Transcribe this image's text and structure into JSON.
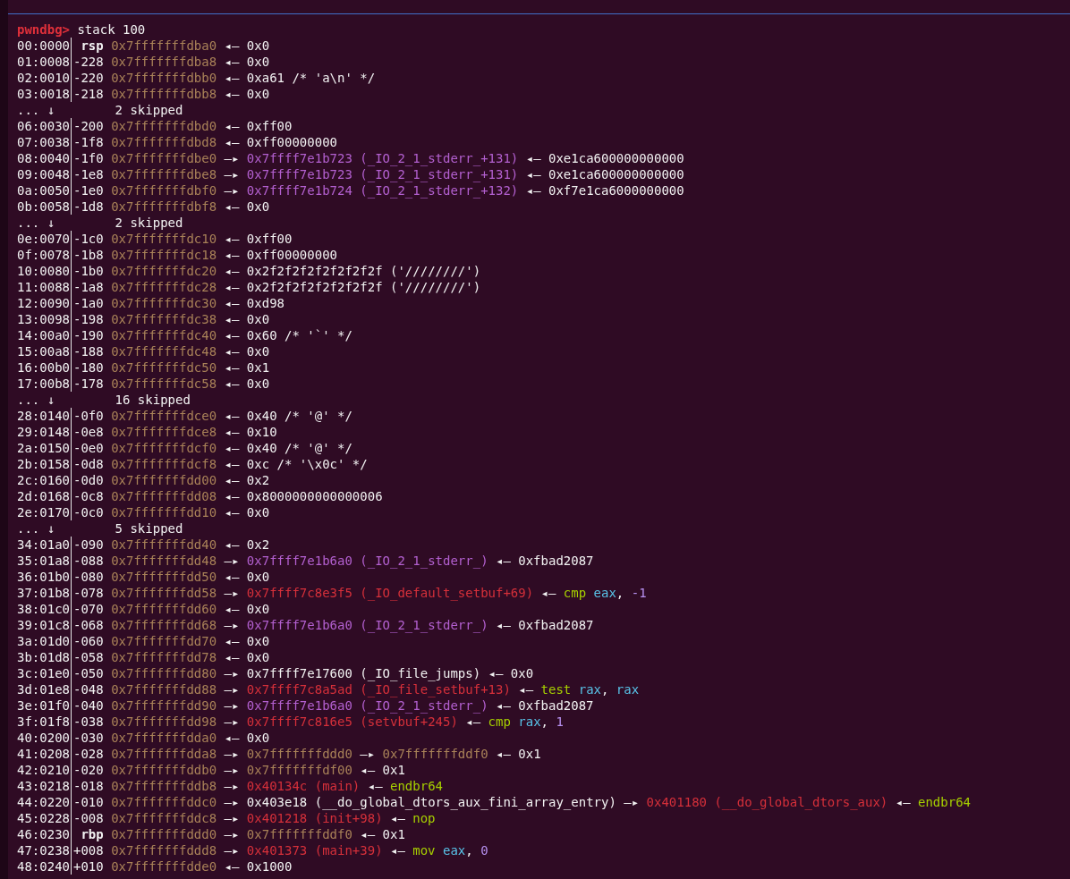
{
  "prompt": {
    "label": "pwndbg>",
    "command": "stack 100"
  },
  "lines": [
    {
      "kind": "entry",
      "index": "00:0000",
      "offset": {
        "text": "rsp",
        "kind": "register"
      },
      "segments": [
        {
          "text": "0x7fffffffdba0",
          "kind": "stack"
        },
        {
          "text": "◂—",
          "kind": "arrow"
        },
        {
          "text": "0x0",
          "kind": "plain"
        }
      ]
    },
    {
      "kind": "entry",
      "index": "01:0008",
      "offset": {
        "text": "-228",
        "kind": "number"
      },
      "segments": [
        {
          "text": "0x7fffffffdba8",
          "kind": "stack"
        },
        {
          "text": "◂—",
          "kind": "arrow"
        },
        {
          "text": "0x0",
          "kind": "plain"
        }
      ]
    },
    {
      "kind": "entry",
      "index": "02:0010",
      "offset": {
        "text": "-220",
        "kind": "number"
      },
      "segments": [
        {
          "text": "0x7fffffffdbb0",
          "kind": "stack"
        },
        {
          "text": "◂—",
          "kind": "arrow"
        },
        {
          "text": "0xa61 /* 'a\\n' */",
          "kind": "plain"
        }
      ]
    },
    {
      "kind": "entry",
      "index": "03:0018",
      "offset": {
        "text": "-218",
        "kind": "number"
      },
      "segments": [
        {
          "text": "0x7fffffffdbb8",
          "kind": "stack"
        },
        {
          "text": "◂—",
          "kind": "arrow"
        },
        {
          "text": "0x0",
          "kind": "plain"
        }
      ]
    },
    {
      "kind": "skip",
      "marker": "... ↓",
      "count": "2 skipped"
    },
    {
      "kind": "entry",
      "index": "06:0030",
      "offset": {
        "text": "-200",
        "kind": "number"
      },
      "segments": [
        {
          "text": "0x7fffffffdbd0",
          "kind": "stack"
        },
        {
          "text": "◂—",
          "kind": "arrow"
        },
        {
          "text": "0xff00",
          "kind": "plain"
        }
      ]
    },
    {
      "kind": "entry",
      "index": "07:0038",
      "offset": {
        "text": "-1f8",
        "kind": "number"
      },
      "segments": [
        {
          "text": "0x7fffffffdbd8",
          "kind": "stack"
        },
        {
          "text": "◂—",
          "kind": "arrow"
        },
        {
          "text": "0xff00000000",
          "kind": "plain"
        }
      ]
    },
    {
      "kind": "entry",
      "index": "08:0040",
      "offset": {
        "text": "-1f0",
        "kind": "number"
      },
      "segments": [
        {
          "text": "0x7fffffffdbe0",
          "kind": "stack"
        },
        {
          "text": "—▸",
          "kind": "arrow"
        },
        {
          "text": "0x7ffff7e1b723 (_IO_2_1_stderr_+131)",
          "kind": "data"
        },
        {
          "text": "◂—",
          "kind": "arrow"
        },
        {
          "text": "0xe1ca600000000000",
          "kind": "plain"
        }
      ]
    },
    {
      "kind": "entry",
      "index": "09:0048",
      "offset": {
        "text": "-1e8",
        "kind": "number"
      },
      "segments": [
        {
          "text": "0x7fffffffdbe8",
          "kind": "stack"
        },
        {
          "text": "—▸",
          "kind": "arrow"
        },
        {
          "text": "0x7ffff7e1b723 (_IO_2_1_stderr_+131)",
          "kind": "data"
        },
        {
          "text": "◂—",
          "kind": "arrow"
        },
        {
          "text": "0xe1ca600000000000",
          "kind": "plain"
        }
      ]
    },
    {
      "kind": "entry",
      "index": "0a:0050",
      "offset": {
        "text": "-1e0",
        "kind": "number"
      },
      "segments": [
        {
          "text": "0x7fffffffdbf0",
          "kind": "stack"
        },
        {
          "text": "—▸",
          "kind": "arrow"
        },
        {
          "text": "0x7ffff7e1b724 (_IO_2_1_stderr_+132)",
          "kind": "data"
        },
        {
          "text": "◂—",
          "kind": "arrow"
        },
        {
          "text": "0xf7e1ca6000000000",
          "kind": "plain"
        }
      ]
    },
    {
      "kind": "entry",
      "index": "0b:0058",
      "offset": {
        "text": "-1d8",
        "kind": "number"
      },
      "segments": [
        {
          "text": "0x7fffffffdbf8",
          "kind": "stack"
        },
        {
          "text": "◂—",
          "kind": "arrow"
        },
        {
          "text": "0x0",
          "kind": "plain"
        }
      ]
    },
    {
      "kind": "skip",
      "marker": "... ↓",
      "count": "2 skipped"
    },
    {
      "kind": "entry",
      "index": "0e:0070",
      "offset": {
        "text": "-1c0",
        "kind": "number"
      },
      "segments": [
        {
          "text": "0x7fffffffdc10",
          "kind": "stack"
        },
        {
          "text": "◂—",
          "kind": "arrow"
        },
        {
          "text": "0xff00",
          "kind": "plain"
        }
      ]
    },
    {
      "kind": "entry",
      "index": "0f:0078",
      "offset": {
        "text": "-1b8",
        "kind": "number"
      },
      "segments": [
        {
          "text": "0x7fffffffdc18",
          "kind": "stack"
        },
        {
          "text": "◂—",
          "kind": "arrow"
        },
        {
          "text": "0xff00000000",
          "kind": "plain"
        }
      ]
    },
    {
      "kind": "entry",
      "index": "10:0080",
      "offset": {
        "text": "-1b0",
        "kind": "number"
      },
      "segments": [
        {
          "text": "0x7fffffffdc20",
          "kind": "stack"
        },
        {
          "text": "◂—",
          "kind": "arrow"
        },
        {
          "text": "0x2f2f2f2f2f2f2f2f ('////////')",
          "kind": "plain"
        }
      ]
    },
    {
      "kind": "entry",
      "index": "11:0088",
      "offset": {
        "text": "-1a8",
        "kind": "number"
      },
      "segments": [
        {
          "text": "0x7fffffffdc28",
          "kind": "stack"
        },
        {
          "text": "◂—",
          "kind": "arrow"
        },
        {
          "text": "0x2f2f2f2f2f2f2f2f ('////////')",
          "kind": "plain"
        }
      ]
    },
    {
      "kind": "entry",
      "index": "12:0090",
      "offset": {
        "text": "-1a0",
        "kind": "number"
      },
      "segments": [
        {
          "text": "0x7fffffffdc30",
          "kind": "stack"
        },
        {
          "text": "◂—",
          "kind": "arrow"
        },
        {
          "text": "0xd98",
          "kind": "plain"
        }
      ]
    },
    {
      "kind": "entry",
      "index": "13:0098",
      "offset": {
        "text": "-198",
        "kind": "number"
      },
      "segments": [
        {
          "text": "0x7fffffffdc38",
          "kind": "stack"
        },
        {
          "text": "◂—",
          "kind": "arrow"
        },
        {
          "text": "0x0",
          "kind": "plain"
        }
      ]
    },
    {
      "kind": "entry",
      "index": "14:00a0",
      "offset": {
        "text": "-190",
        "kind": "number"
      },
      "segments": [
        {
          "text": "0x7fffffffdc40",
          "kind": "stack"
        },
        {
          "text": "◂—",
          "kind": "arrow"
        },
        {
          "text": "0x60 /* '`' */",
          "kind": "plain"
        }
      ]
    },
    {
      "kind": "entry",
      "index": "15:00a8",
      "offset": {
        "text": "-188",
        "kind": "number"
      },
      "segments": [
        {
          "text": "0x7fffffffdc48",
          "kind": "stack"
        },
        {
          "text": "◂—",
          "kind": "arrow"
        },
        {
          "text": "0x0",
          "kind": "plain"
        }
      ]
    },
    {
      "kind": "entry",
      "index": "16:00b0",
      "offset": {
        "text": "-180",
        "kind": "number"
      },
      "segments": [
        {
          "text": "0x7fffffffdc50",
          "kind": "stack"
        },
        {
          "text": "◂—",
          "kind": "arrow"
        },
        {
          "text": "0x1",
          "kind": "plain"
        }
      ]
    },
    {
      "kind": "entry",
      "index": "17:00b8",
      "offset": {
        "text": "-178",
        "kind": "number"
      },
      "segments": [
        {
          "text": "0x7fffffffdc58",
          "kind": "stack"
        },
        {
          "text": "◂—",
          "kind": "arrow"
        },
        {
          "text": "0x0",
          "kind": "plain"
        }
      ]
    },
    {
      "kind": "skip",
      "marker": "... ↓",
      "count": "16 skipped"
    },
    {
      "kind": "entry",
      "index": "28:0140",
      "offset": {
        "text": "-0f0",
        "kind": "number"
      },
      "segments": [
        {
          "text": "0x7fffffffdce0",
          "kind": "stack"
        },
        {
          "text": "◂—",
          "kind": "arrow"
        },
        {
          "text": "0x40 /* '@' */",
          "kind": "plain"
        }
      ]
    },
    {
      "kind": "entry",
      "index": "29:0148",
      "offset": {
        "text": "-0e8",
        "kind": "number"
      },
      "segments": [
        {
          "text": "0x7fffffffdce8",
          "kind": "stack"
        },
        {
          "text": "◂—",
          "kind": "arrow"
        },
        {
          "text": "0x10",
          "kind": "plain"
        }
      ]
    },
    {
      "kind": "entry",
      "index": "2a:0150",
      "offset": {
        "text": "-0e0",
        "kind": "number"
      },
      "segments": [
        {
          "text": "0x7fffffffdcf0",
          "kind": "stack"
        },
        {
          "text": "◂—",
          "kind": "arrow"
        },
        {
          "text": "0x40 /* '@' */",
          "kind": "plain"
        }
      ]
    },
    {
      "kind": "entry",
      "index": "2b:0158",
      "offset": {
        "text": "-0d8",
        "kind": "number"
      },
      "segments": [
        {
          "text": "0x7fffffffdcf8",
          "kind": "stack"
        },
        {
          "text": "◂—",
          "kind": "arrow"
        },
        {
          "text": "0xc /* '\\x0c' */",
          "kind": "plain"
        }
      ]
    },
    {
      "kind": "entry",
      "index": "2c:0160",
      "offset": {
        "text": "-0d0",
        "kind": "number"
      },
      "segments": [
        {
          "text": "0x7fffffffdd00",
          "kind": "stack"
        },
        {
          "text": "◂—",
          "kind": "arrow"
        },
        {
          "text": "0x2",
          "kind": "plain"
        }
      ]
    },
    {
      "kind": "entry",
      "index": "2d:0168",
      "offset": {
        "text": "-0c8",
        "kind": "number"
      },
      "segments": [
        {
          "text": "0x7fffffffdd08",
          "kind": "stack"
        },
        {
          "text": "◂—",
          "kind": "arrow"
        },
        {
          "text": "0x8000000000000006",
          "kind": "plain"
        }
      ]
    },
    {
      "kind": "entry",
      "index": "2e:0170",
      "offset": {
        "text": "-0c0",
        "kind": "number"
      },
      "segments": [
        {
          "text": "0x7fffffffdd10",
          "kind": "stack"
        },
        {
          "text": "◂—",
          "kind": "arrow"
        },
        {
          "text": "0x0",
          "kind": "plain"
        }
      ]
    },
    {
      "kind": "skip",
      "marker": "... ↓",
      "count": "5 skipped"
    },
    {
      "kind": "entry",
      "index": "34:01a0",
      "offset": {
        "text": "-090",
        "kind": "number"
      },
      "segments": [
        {
          "text": "0x7fffffffdd40",
          "kind": "stack"
        },
        {
          "text": "◂—",
          "kind": "arrow"
        },
        {
          "text": "0x2",
          "kind": "plain"
        }
      ]
    },
    {
      "kind": "entry",
      "index": "35:01a8",
      "offset": {
        "text": "-088",
        "kind": "number"
      },
      "segments": [
        {
          "text": "0x7fffffffdd48",
          "kind": "stack"
        },
        {
          "text": "—▸",
          "kind": "arrow"
        },
        {
          "text": "0x7ffff7e1b6a0 (_IO_2_1_stderr_)",
          "kind": "data"
        },
        {
          "text": "◂—",
          "kind": "arrow"
        },
        {
          "text": "0xfbad2087",
          "kind": "plain"
        }
      ]
    },
    {
      "kind": "entry",
      "index": "36:01b0",
      "offset": {
        "text": "-080",
        "kind": "number"
      },
      "segments": [
        {
          "text": "0x7fffffffdd50",
          "kind": "stack"
        },
        {
          "text": "◂—",
          "kind": "arrow"
        },
        {
          "text": "0x0",
          "kind": "plain"
        }
      ]
    },
    {
      "kind": "entry",
      "index": "37:01b8",
      "offset": {
        "text": "-078",
        "kind": "number"
      },
      "segments": [
        {
          "text": "0x7fffffffdd58",
          "kind": "stack"
        },
        {
          "text": "—▸",
          "kind": "arrow"
        },
        {
          "text": "0x7ffff7c8e3f5 (_IO_default_setbuf+69)",
          "kind": "code"
        },
        {
          "text": "◂—",
          "kind": "arrow"
        },
        {
          "text": "cmp",
          "kind": "mnemonic"
        },
        {
          "text": "eax",
          "kind": "register"
        },
        {
          "text": ",",
          "kind": "comma"
        },
        {
          "text": "-1",
          "kind": "number"
        }
      ]
    },
    {
      "kind": "entry",
      "index": "38:01c0",
      "offset": {
        "text": "-070",
        "kind": "number"
      },
      "segments": [
        {
          "text": "0x7fffffffdd60",
          "kind": "stack"
        },
        {
          "text": "◂—",
          "kind": "arrow"
        },
        {
          "text": "0x0",
          "kind": "plain"
        }
      ]
    },
    {
      "kind": "entry",
      "index": "39:01c8",
      "offset": {
        "text": "-068",
        "kind": "number"
      },
      "segments": [
        {
          "text": "0x7fffffffdd68",
          "kind": "stack"
        },
        {
          "text": "—▸",
          "kind": "arrow"
        },
        {
          "text": "0x7ffff7e1b6a0 (_IO_2_1_stderr_)",
          "kind": "data"
        },
        {
          "text": "◂—",
          "kind": "arrow"
        },
        {
          "text": "0xfbad2087",
          "kind": "plain"
        }
      ]
    },
    {
      "kind": "entry",
      "index": "3a:01d0",
      "offset": {
        "text": "-060",
        "kind": "number"
      },
      "segments": [
        {
          "text": "0x7fffffffdd70",
          "kind": "stack"
        },
        {
          "text": "◂—",
          "kind": "arrow"
        },
        {
          "text": "0x0",
          "kind": "plain"
        }
      ]
    },
    {
      "kind": "entry",
      "index": "3b:01d8",
      "offset": {
        "text": "-058",
        "kind": "number"
      },
      "segments": [
        {
          "text": "0x7fffffffdd78",
          "kind": "stack"
        },
        {
          "text": "◂—",
          "kind": "arrow"
        },
        {
          "text": "0x0",
          "kind": "plain"
        }
      ]
    },
    {
      "kind": "entry",
      "index": "3c:01e0",
      "offset": {
        "text": "-050",
        "kind": "number"
      },
      "segments": [
        {
          "text": "0x7fffffffdd80",
          "kind": "stack"
        },
        {
          "text": "—▸",
          "kind": "arrow"
        },
        {
          "text": "0x7ffff7e17600 (_IO_file_jumps)",
          "kind": "plain"
        },
        {
          "text": "◂—",
          "kind": "arrow"
        },
        {
          "text": "0x0",
          "kind": "plain"
        }
      ]
    },
    {
      "kind": "entry",
      "index": "3d:01e8",
      "offset": {
        "text": "-048",
        "kind": "number"
      },
      "segments": [
        {
          "text": "0x7fffffffdd88",
          "kind": "stack"
        },
        {
          "text": "—▸",
          "kind": "arrow"
        },
        {
          "text": "0x7ffff7c8a5ad (_IO_file_setbuf+13)",
          "kind": "code"
        },
        {
          "text": "◂—",
          "kind": "arrow"
        },
        {
          "text": "test",
          "kind": "mnemonic"
        },
        {
          "text": "rax",
          "kind": "register"
        },
        {
          "text": ",",
          "kind": "comma"
        },
        {
          "text": "rax",
          "kind": "register"
        }
      ]
    },
    {
      "kind": "entry",
      "index": "3e:01f0",
      "offset": {
        "text": "-040",
        "kind": "number"
      },
      "segments": [
        {
          "text": "0x7fffffffdd90",
          "kind": "stack"
        },
        {
          "text": "—▸",
          "kind": "arrow"
        },
        {
          "text": "0x7ffff7e1b6a0 (_IO_2_1_stderr_)",
          "kind": "data"
        },
        {
          "text": "◂—",
          "kind": "arrow"
        },
        {
          "text": "0xfbad2087",
          "kind": "plain"
        }
      ]
    },
    {
      "kind": "entry",
      "index": "3f:01f8",
      "offset": {
        "text": "-038",
        "kind": "number"
      },
      "segments": [
        {
          "text": "0x7fffffffdd98",
          "kind": "stack"
        },
        {
          "text": "—▸",
          "kind": "arrow"
        },
        {
          "text": "0x7ffff7c816e5 (setvbuf+245)",
          "kind": "code"
        },
        {
          "text": "◂—",
          "kind": "arrow"
        },
        {
          "text": "cmp",
          "kind": "mnemonic"
        },
        {
          "text": "rax",
          "kind": "register"
        },
        {
          "text": ",",
          "kind": "comma"
        },
        {
          "text": "1",
          "kind": "number"
        }
      ]
    },
    {
      "kind": "entry",
      "index": "40:0200",
      "offset": {
        "text": "-030",
        "kind": "number"
      },
      "segments": [
        {
          "text": "0x7fffffffdda0",
          "kind": "stack"
        },
        {
          "text": "◂—",
          "kind": "arrow"
        },
        {
          "text": "0x0",
          "kind": "plain"
        }
      ]
    },
    {
      "kind": "entry",
      "index": "41:0208",
      "offset": {
        "text": "-028",
        "kind": "number"
      },
      "segments": [
        {
          "text": "0x7fffffffdda8",
          "kind": "stack"
        },
        {
          "text": "—▸",
          "kind": "arrow"
        },
        {
          "text": "0x7fffffffddd0",
          "kind": "stack"
        },
        {
          "text": "—▸",
          "kind": "arrow"
        },
        {
          "text": "0x7fffffffddf0",
          "kind": "stack"
        },
        {
          "text": "◂—",
          "kind": "arrow"
        },
        {
          "text": "0x1",
          "kind": "plain"
        }
      ]
    },
    {
      "kind": "entry",
      "index": "42:0210",
      "offset": {
        "text": "-020",
        "kind": "number"
      },
      "segments": [
        {
          "text": "0x7fffffffddb0",
          "kind": "stack"
        },
        {
          "text": "—▸",
          "kind": "arrow"
        },
        {
          "text": "0x7fffffffdf00",
          "kind": "stack"
        },
        {
          "text": "◂—",
          "kind": "arrow"
        },
        {
          "text": "0x1",
          "kind": "plain"
        }
      ]
    },
    {
      "kind": "entry",
      "index": "43:0218",
      "offset": {
        "text": "-018",
        "kind": "number"
      },
      "segments": [
        {
          "text": "0x7fffffffddb8",
          "kind": "stack"
        },
        {
          "text": "—▸",
          "kind": "arrow"
        },
        {
          "text": "0x40134c (main)",
          "kind": "code"
        },
        {
          "text": "◂—",
          "kind": "arrow"
        },
        {
          "text": "endbr64",
          "kind": "mnemonic"
        }
      ]
    },
    {
      "kind": "entry",
      "index": "44:0220",
      "offset": {
        "text": "-010",
        "kind": "number"
      },
      "segments": [
        {
          "text": "0x7fffffffddc0",
          "kind": "stack"
        },
        {
          "text": "—▸",
          "kind": "arrow"
        },
        {
          "text": "0x403e18 (__do_global_dtors_aux_fini_array_entry)",
          "kind": "plain"
        },
        {
          "text": "—▸",
          "kind": "arrow"
        },
        {
          "text": "0x401180 (__do_global_dtors_aux)",
          "kind": "code"
        },
        {
          "text": "◂—",
          "kind": "arrow"
        },
        {
          "text": "endbr64",
          "kind": "mnemonic"
        }
      ]
    },
    {
      "kind": "entry",
      "index": "45:0228",
      "offset": {
        "text": "-008",
        "kind": "number"
      },
      "segments": [
        {
          "text": "0x7fffffffddc8",
          "kind": "stack"
        },
        {
          "text": "—▸",
          "kind": "arrow"
        },
        {
          "text": "0x401218 (init+98)",
          "kind": "code"
        },
        {
          "text": "◂—",
          "kind": "arrow"
        },
        {
          "text": "nop",
          "kind": "mnemonic"
        }
      ]
    },
    {
      "kind": "entry",
      "index": "46:0230",
      "offset": {
        "text": "rbp",
        "kind": "register"
      },
      "segments": [
        {
          "text": "0x7fffffffddd0",
          "kind": "stack"
        },
        {
          "text": "—▸",
          "kind": "arrow"
        },
        {
          "text": "0x7fffffffddf0",
          "kind": "stack"
        },
        {
          "text": "◂—",
          "kind": "arrow"
        },
        {
          "text": "0x1",
          "kind": "plain"
        }
      ]
    },
    {
      "kind": "entry",
      "index": "47:0238",
      "offset": {
        "text": "+008",
        "kind": "number"
      },
      "segments": [
        {
          "text": "0x7fffffffddd8",
          "kind": "stack"
        },
        {
          "text": "—▸",
          "kind": "arrow"
        },
        {
          "text": "0x401373 (main+39)",
          "kind": "code"
        },
        {
          "text": "◂—",
          "kind": "arrow"
        },
        {
          "text": "mov",
          "kind": "mnemonic"
        },
        {
          "text": "eax",
          "kind": "register"
        },
        {
          "text": ",",
          "kind": "comma"
        },
        {
          "text": "0",
          "kind": "number"
        }
      ]
    },
    {
      "kind": "entry",
      "index": "48:0240",
      "offset": {
        "text": "+010",
        "kind": "number"
      },
      "segments": [
        {
          "text": "0x7fffffffdde0",
          "kind": "stack"
        },
        {
          "text": "◂—",
          "kind": "arrow"
        },
        {
          "text": "0x1000",
          "kind": "plain"
        }
      ]
    }
  ]
}
